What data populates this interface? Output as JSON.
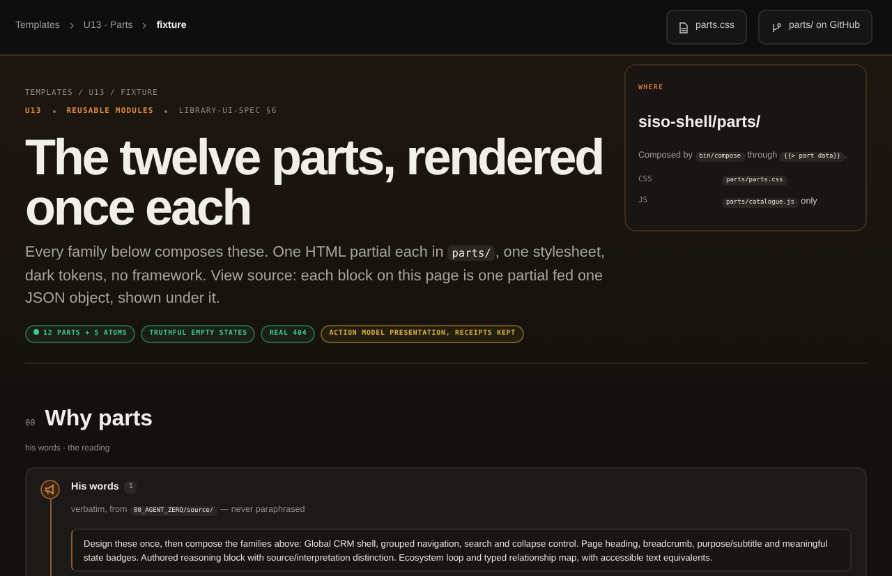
{
  "breadcrumb": [
    {
      "label": "Templates",
      "current": false
    },
    {
      "label": "U13 · Parts",
      "current": false
    },
    {
      "label": "fixture",
      "current": true
    }
  ],
  "header_buttons": [
    {
      "label": "parts.css",
      "kind": "file"
    },
    {
      "label": "parts/ on GitHub",
      "kind": "branch"
    }
  ],
  "hero": {
    "path": "TEMPLATES / U13 / FIXTURE",
    "eyebrow": [
      {
        "text": "U13",
        "kind": "accent"
      },
      {
        "text": "REUSABLE MODULES",
        "kind": "accent"
      },
      {
        "text": "LIBRARY-UI-SPEC §6",
        "kind": "muted"
      }
    ],
    "title": "The twelve parts, rendered once each",
    "lead": [
      {
        "text": "Every family below composes these. One HTML partial each in ",
        "kind": "text"
      },
      {
        "text": "parts/",
        "kind": "code"
      },
      {
        "text": ", one stylesheet, dark tokens, no framework. View source: each block on this page is one partial fed one JSON object, shown under it.",
        "kind": "text"
      }
    ],
    "tags": [
      {
        "label": "12 PARTS + 5 ATOMS",
        "color": "#3fc98f",
        "dot": true
      },
      {
        "label": "TRUTHFUL EMPTY STATES",
        "color": "#3fc98f",
        "dot": false
      },
      {
        "label": "REAL 404",
        "color": "#3fc98f",
        "dot": false
      },
      {
        "label": "ACTION MODEL PRESENTATION, RECEIPTS KEPT",
        "color": "#d9b43c",
        "dot": false
      }
    ]
  },
  "where_card": {
    "label": "WHERE",
    "title": "siso-shell/parts/",
    "description": [
      {
        "text": "Composed by ",
        "kind": "text"
      },
      {
        "text": "bin/compose",
        "kind": "code"
      },
      {
        "text": " through ",
        "kind": "text"
      },
      {
        "text": "{{> part data}}",
        "kind": "code"
      },
      {
        "text": ".",
        "kind": "text"
      }
    ],
    "rows": [
      {
        "key": "CSS",
        "value": "parts/parts.css",
        "suffix": ""
      },
      {
        "key": "JS",
        "value": "parts/catalogue.js",
        "suffix": "only"
      }
    ]
  },
  "section": {
    "number": "00",
    "title": "Why parts",
    "subtitle": "his words · the reading"
  },
  "quote_card": {
    "title": "His words",
    "count": "1",
    "source": [
      {
        "text": "verbatim, from ",
        "kind": "text"
      },
      {
        "text": "00_AGENT_ZERO/source/",
        "kind": "code"
      },
      {
        "text": " — never paraphrased",
        "kind": "text"
      }
    ],
    "body": "Design these once, then compose the families above: Global CRM shell, grouped navigation, search and collapse control. Page heading, breadcrumb, purpose/subtitle and meaningful state badges. Authored reasoning block with source/interpretation distinction. Ecosystem loop and typed relationship map, with accessible text equivalents."
  }
}
